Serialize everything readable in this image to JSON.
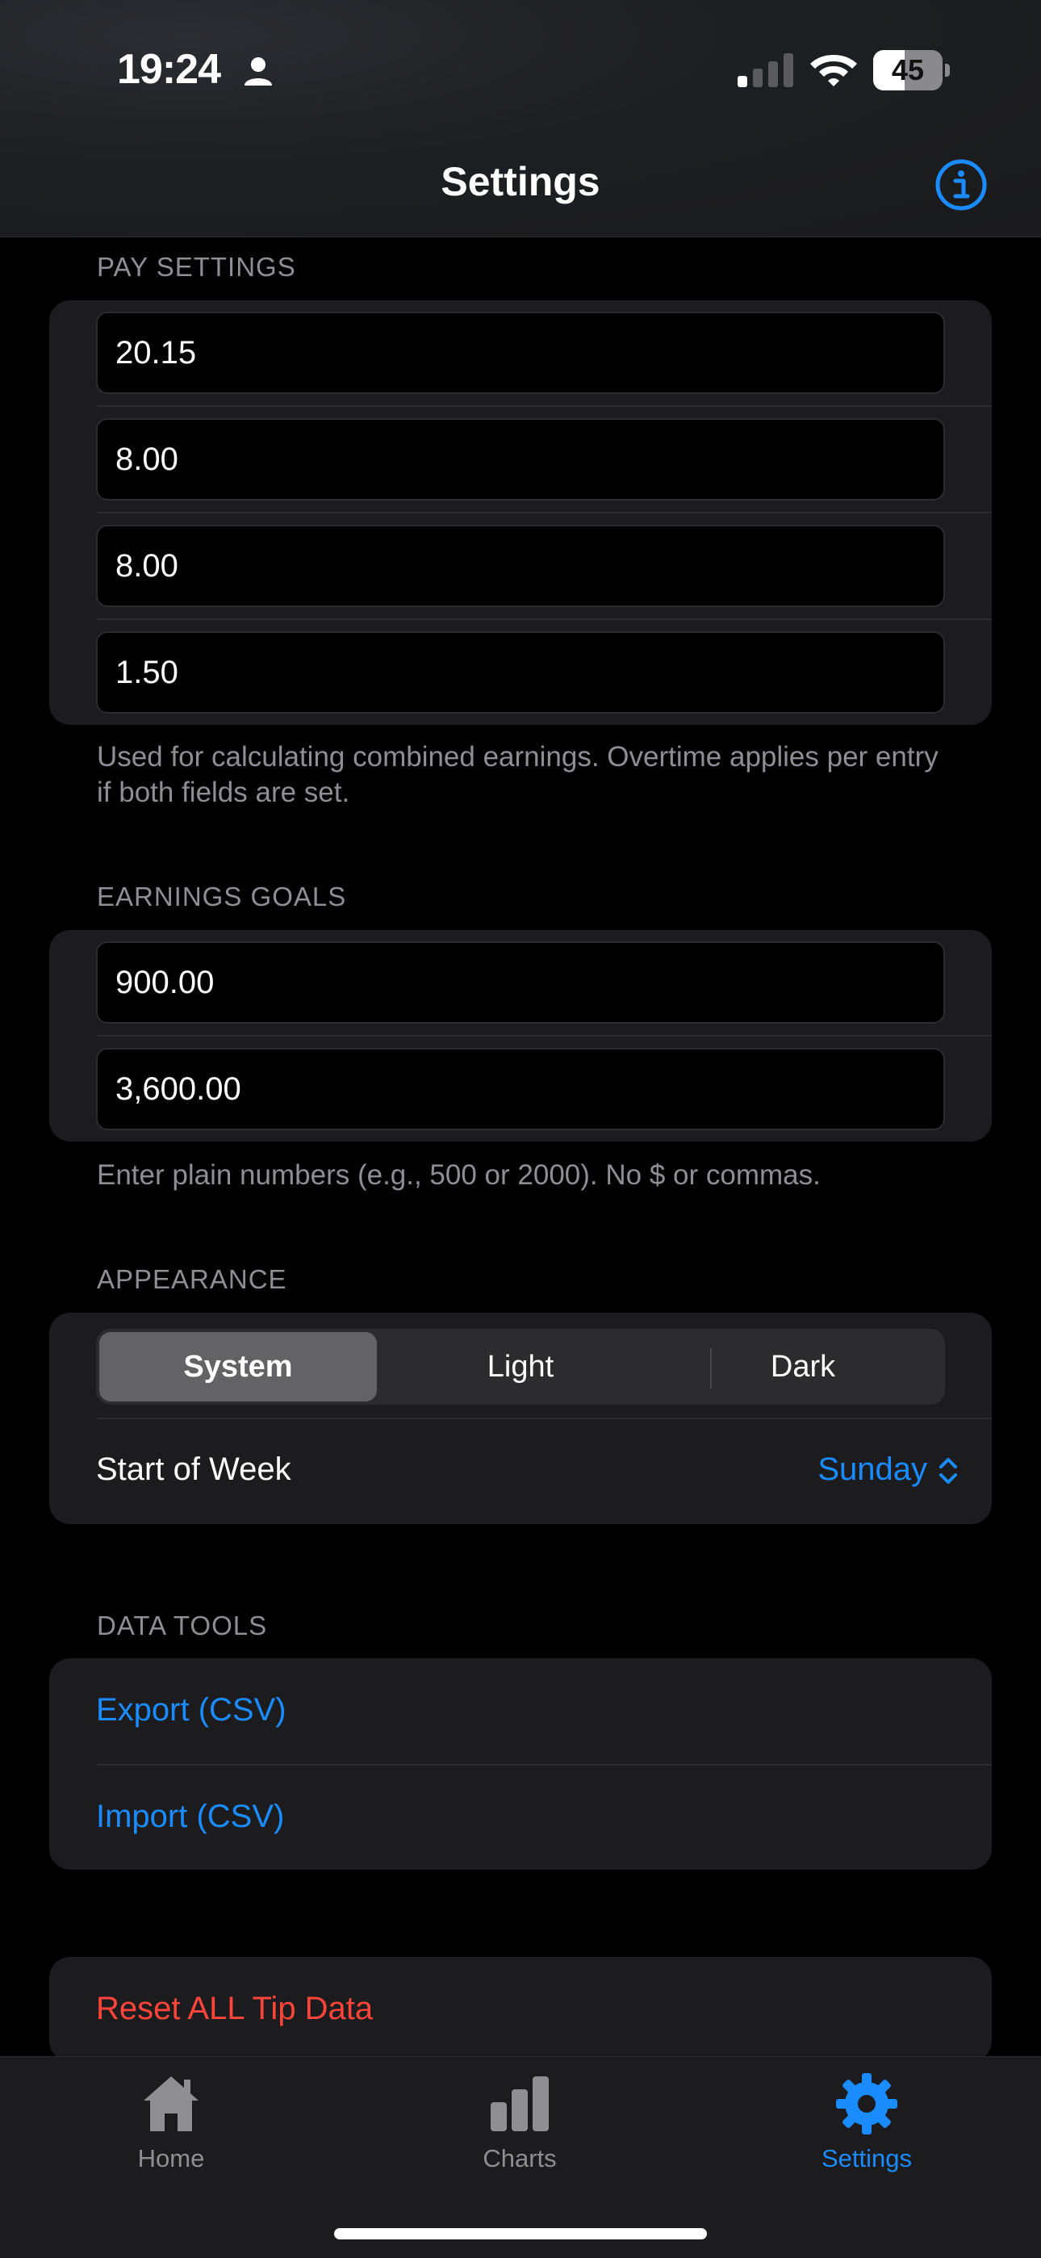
{
  "status": {
    "time": "19:24",
    "battery": "45",
    "battery_level": 0.45
  },
  "nav": {
    "title": "Settings"
  },
  "pay_settings": {
    "header": "PAY SETTINGS",
    "fields": [
      "20.15",
      "8.00",
      "8.00",
      "1.50"
    ],
    "footnote": "Used for calculating combined earnings. Overtime applies per entry if both fields are set."
  },
  "earnings_goals": {
    "header": "EARNINGS GOALS",
    "fields": [
      "900.00",
      "3,600.00"
    ],
    "footnote": "Enter plain numbers (e.g., 500 or 2000). No $ or commas."
  },
  "appearance": {
    "header": "APPEARANCE",
    "options": [
      "System",
      "Light",
      "Dark"
    ],
    "selected": "System",
    "start_of_week_label": "Start of Week",
    "start_of_week_value": "Sunday"
  },
  "data_tools": {
    "header": "DATA TOOLS",
    "export_label": "Export (CSV)",
    "import_label": "Import (CSV)"
  },
  "danger": {
    "reset_label": "Reset ALL Tip Data"
  },
  "tabs": [
    {
      "label": "Home",
      "icon": "house-icon"
    },
    {
      "label": "Charts",
      "icon": "chart-bar-icon"
    },
    {
      "label": "Settings",
      "icon": "gear-icon"
    }
  ],
  "colors": {
    "accent": "#1a8cff",
    "danger": "#ff453a",
    "card": "#1c1c1e",
    "background": "#000000"
  }
}
